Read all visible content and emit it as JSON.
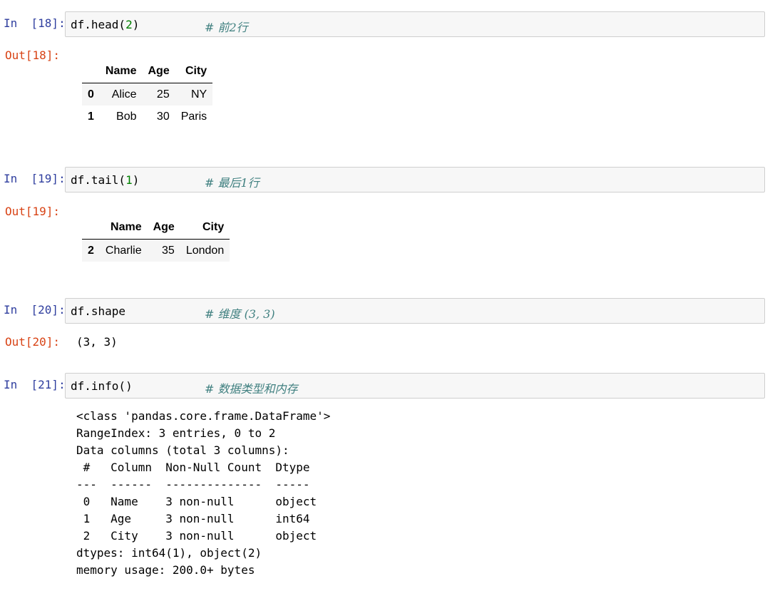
{
  "cells": [
    {
      "in_prompt": "In  [18]:",
      "code_prefix": "df.head(",
      "code_num": "2",
      "code_suffix": ")",
      "comment": "# 前2行",
      "out_prompt": "Out[18]:",
      "table": {
        "columns": [
          "Name",
          "Age",
          "City"
        ],
        "rows": [
          {
            "index": "0",
            "values": [
              "Alice",
              "25",
              "NY"
            ]
          },
          {
            "index": "1",
            "values": [
              "Bob",
              "30",
              "Paris"
            ]
          }
        ]
      }
    },
    {
      "in_prompt": "In  [19]:",
      "code_prefix": "df.tail(",
      "code_num": "1",
      "code_suffix": ")",
      "comment": "# 最后1行",
      "out_prompt": "Out[19]:",
      "table": {
        "columns": [
          "Name",
          "Age",
          "City"
        ],
        "rows": [
          {
            "index": "2",
            "values": [
              "Charlie",
              "35",
              "London"
            ]
          }
        ]
      }
    },
    {
      "in_prompt": "In  [20]:",
      "code": "df.shape",
      "comment": "# 维度 (3, 3)",
      "out_prompt": "Out[20]:",
      "output": "(3, 3)"
    },
    {
      "in_prompt": "In  [21]:",
      "code": "df.info()",
      "comment": "# 数据类型和内存",
      "stdout": "<class 'pandas.core.frame.DataFrame'>\nRangeIndex: 3 entries, 0 to 2\nData columns (total 3 columns):\n #   Column  Non-Null Count  Dtype \n---  ------  --------------  ----- \n 0   Name    3 non-null      object\n 1   Age     3 non-null      int64 \n 2   City    3 non-null      object\ndtypes: int64(1), object(2)\nmemory usage: 200.0+ bytes"
    }
  ]
}
